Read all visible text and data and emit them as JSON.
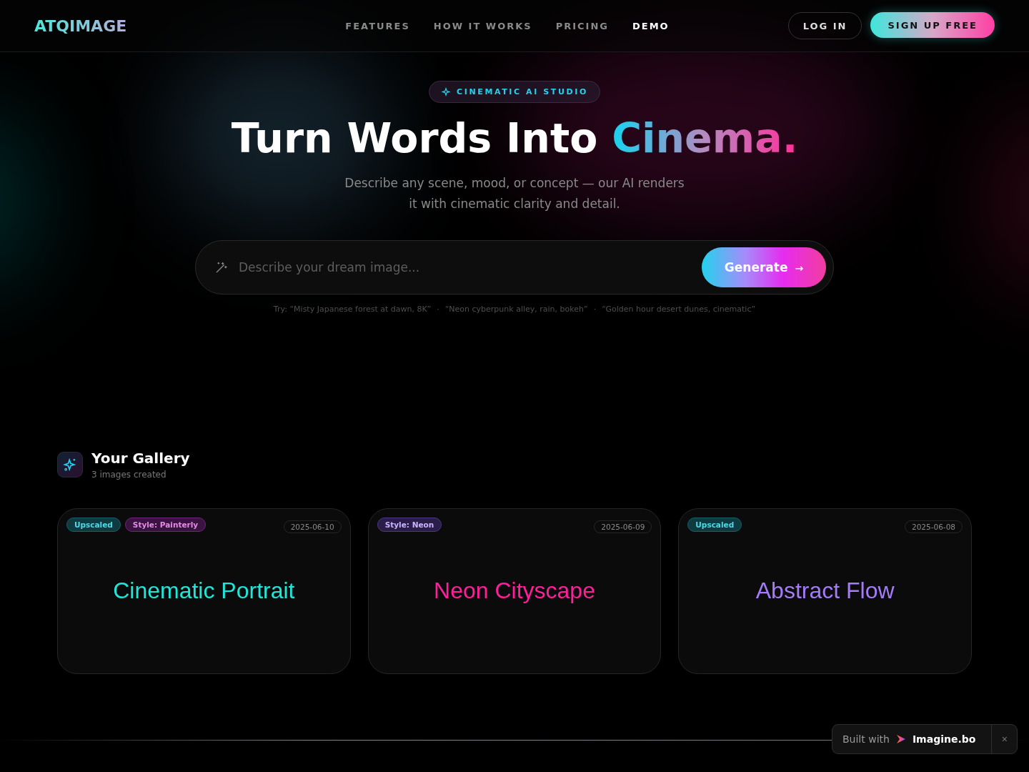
{
  "header": {
    "logo": "ATQIMAGE",
    "nav": [
      {
        "label": "FEATURES",
        "selected": false
      },
      {
        "label": "HOW IT WORKS",
        "selected": false
      },
      {
        "label": "PRICING",
        "selected": false
      },
      {
        "label": "DEMO",
        "selected": true
      }
    ],
    "login": "LOG IN",
    "signup": "SIGN UP FREE"
  },
  "hero": {
    "badge": "CINEMATIC AI STUDIO",
    "title": "Turn Words Into",
    "title_highlight": "Cinema.",
    "subtitle_lines": [
      "Describe any scene, mood, or concept — our AI renders",
      "it with cinematic clarity and detail."
    ],
    "prompt": {
      "placeholder": "Describe your dream image...",
      "button": "Generate",
      "button_icon": "→"
    },
    "suggestions": [
      "Try: “Misty Japanese forest at dawn, 8K”",
      "·",
      "“Neon cyberpunk alley, rain, bokeh”",
      "·",
      "“Golden hour desert dunes, cinematic”"
    ]
  },
  "gallery": {
    "title": "Your Gallery",
    "count": "3 images created",
    "cards": [
      {
        "title": "Cinematic Portrait",
        "color": "#22e5d9",
        "date": "2025-06-10",
        "tags": [
          {
            "label": "Upscaled",
            "kind": "upscaled"
          },
          {
            "label": "Style: Painterly",
            "kind": "painterly"
          }
        ]
      },
      {
        "title": "Neon Cityscape",
        "color": "#ff1f9a",
        "date": "2025-06-09",
        "tags": [
          {
            "label": "Style: Neon",
            "kind": "neon"
          }
        ]
      },
      {
        "title": "Abstract Flow",
        "color": "#a57cf7",
        "date": "2025-06-08",
        "tags": [
          {
            "label": "Upscaled",
            "kind": "upscaled"
          }
        ]
      }
    ]
  },
  "built_with": {
    "label": "Built with",
    "brand": "Imagine.bo",
    "close": "×"
  }
}
